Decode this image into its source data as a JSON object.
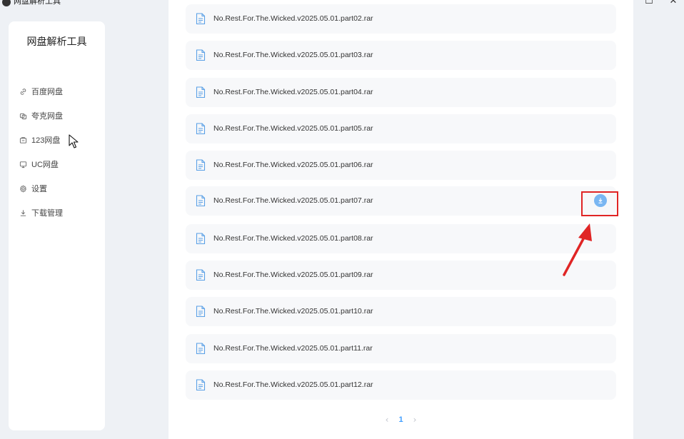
{
  "window": {
    "title": "网盘解析工具",
    "minimize": "—",
    "maximize": "☐",
    "close": "✕"
  },
  "sidebar": {
    "title": "网盘解析工具",
    "items": [
      {
        "label": "百度网盘",
        "icon": "link-icon"
      },
      {
        "label": "夸克网盘",
        "icon": "cloud-icon"
      },
      {
        "label": "123网盘",
        "icon": "drive-icon"
      },
      {
        "label": "UC网盘",
        "icon": "monitor-icon"
      },
      {
        "label": "设置",
        "icon": "gear-icon"
      },
      {
        "label": "下载管理",
        "icon": "download-icon"
      }
    ]
  },
  "files": [
    {
      "name": "No.Rest.For.The.Wicked.v2025.05.01.part02.rar"
    },
    {
      "name": "No.Rest.For.The.Wicked.v2025.05.01.part03.rar"
    },
    {
      "name": "No.Rest.For.The.Wicked.v2025.05.01.part04.rar"
    },
    {
      "name": "No.Rest.For.The.Wicked.v2025.05.01.part05.rar"
    },
    {
      "name": "No.Rest.For.The.Wicked.v2025.05.01.part06.rar"
    },
    {
      "name": "No.Rest.For.The.Wicked.v2025.05.01.part07.rar",
      "hovered": true
    },
    {
      "name": "No.Rest.For.The.Wicked.v2025.05.01.part08.rar"
    },
    {
      "name": "No.Rest.For.The.Wicked.v2025.05.01.part09.rar"
    },
    {
      "name": "No.Rest.For.The.Wicked.v2025.05.01.part10.rar"
    },
    {
      "name": "No.Rest.For.The.Wicked.v2025.05.01.part11.rar"
    },
    {
      "name": "No.Rest.For.The.Wicked.v2025.05.01.part12.rar"
    }
  ],
  "pagination": {
    "prev": "‹",
    "current": "1",
    "next": "›"
  },
  "colors": {
    "accent": "#409eff",
    "download_button": "#79b6f2",
    "annotation": "#e02525"
  }
}
